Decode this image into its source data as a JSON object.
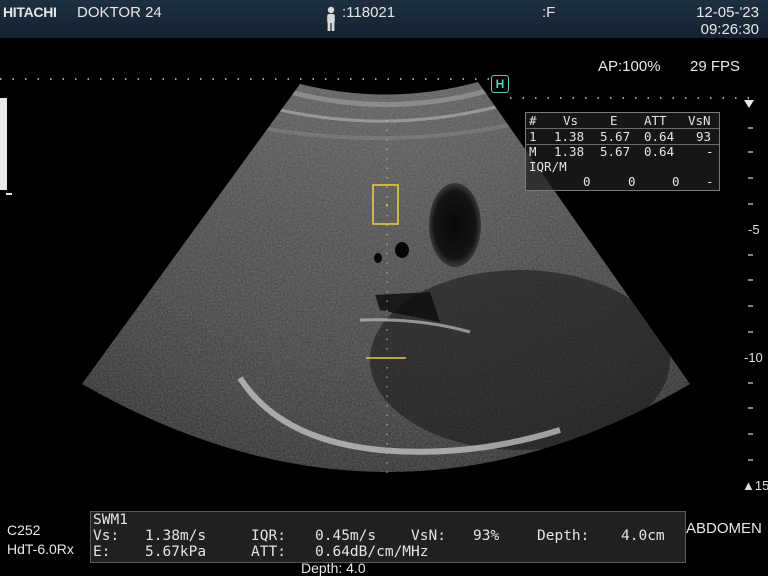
{
  "header": {
    "brand": "HITACHI",
    "doctor": "DOKTOR 24",
    "patient_id": ":118021",
    "sex": ":F",
    "date": "12-05-'23",
    "time": "09:26:30",
    "patient_icon": "person-icon"
  },
  "acquisition": {
    "ap": "AP:100%",
    "fps": "29 FPS",
    "harmonic_icon": "H"
  },
  "measurement_table": {
    "headers": [
      "#",
      "Vs",
      "E",
      "ATT",
      "VsN"
    ],
    "rows": [
      [
        "1",
        "1.38",
        "5.67",
        "0.64",
        "93"
      ],
      [
        "M",
        "1.38",
        "5.67",
        "0.64",
        "-"
      ]
    ],
    "iqr_label": "IQR/M",
    "iqr_values": [
      "0",
      "0",
      "0",
      "-"
    ]
  },
  "depth_scale": {
    "labels": [
      "-5",
      "-10",
      "▲15"
    ]
  },
  "probe": {
    "name": "C252",
    "preset": "HdT-6.0Rx"
  },
  "swm": {
    "title": "SWM1",
    "vs_label": "Vs:",
    "vs_value": "1.38m/s",
    "iqr_label": "IQR:",
    "iqr_value": "0.45m/s",
    "vsn_label": "VsN:",
    "vsn_value": "93%",
    "depth_label": "Depth:",
    "depth_value": "4.0cm",
    "e_label": "E:",
    "e_value": "5.67kPa",
    "att_label": "ATT:",
    "att_value": "0.64dB/cm/MHz"
  },
  "exam_preset": "ABDOMEN",
  "depth_bottom": "Depth: 4.0",
  "colors": {
    "header_bg": "#1a2a38",
    "roi": "#e8c84a",
    "harmonic_icon": "#5ec8c0",
    "panel_border": "#595959"
  }
}
